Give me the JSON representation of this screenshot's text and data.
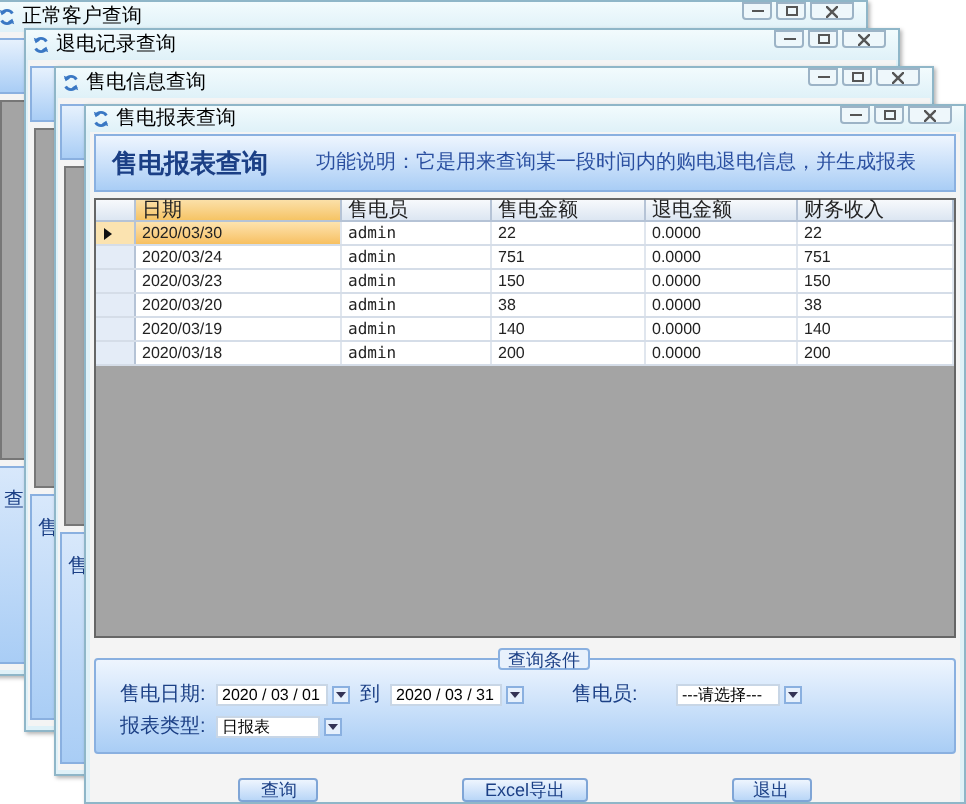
{
  "background_windows": [
    {
      "title": "正常客户查询",
      "edge_label": "查"
    },
    {
      "title": "退电记录查询",
      "edge_label": "售"
    },
    {
      "title": "售电信息查询",
      "edge_label": "售"
    }
  ],
  "window": {
    "title": "售电报表查询"
  },
  "header": {
    "title": "售电报表查询",
    "description": "功能说明：它是用来查询某一段时间内的购电退电信息，并生成报表"
  },
  "table": {
    "columns": [
      "日期",
      "售电员",
      "售电金额",
      "退电金额",
      "财务收入"
    ],
    "rows": [
      {
        "selected": true,
        "cells": [
          "2020/03/30",
          "admin",
          "22",
          "0.0000",
          "22"
        ]
      },
      {
        "selected": false,
        "cells": [
          "2020/03/24",
          "admin",
          "751",
          "0.0000",
          "751"
        ]
      },
      {
        "selected": false,
        "cells": [
          "2020/03/23",
          "admin",
          "150",
          "0.0000",
          "150"
        ]
      },
      {
        "selected": false,
        "cells": [
          "2020/03/20",
          "admin",
          "38",
          "0.0000",
          "38"
        ]
      },
      {
        "selected": false,
        "cells": [
          "2020/03/19",
          "admin",
          "140",
          "0.0000",
          "140"
        ]
      },
      {
        "selected": false,
        "cells": [
          "2020/03/18",
          "admin",
          "200",
          "0.0000",
          "200"
        ]
      }
    ]
  },
  "filters": {
    "legend": "查询条件",
    "date_label": "售电日期:",
    "date_from": "2020 / 03 / 01",
    "to_label": "到",
    "date_to": "2020 / 03 / 31",
    "seller_label": "售电员:",
    "seller_value": "---请选择---",
    "type_label": "报表类型:",
    "type_value": "日报表"
  },
  "buttons": [
    "查询",
    "Excel导出",
    "退出"
  ]
}
